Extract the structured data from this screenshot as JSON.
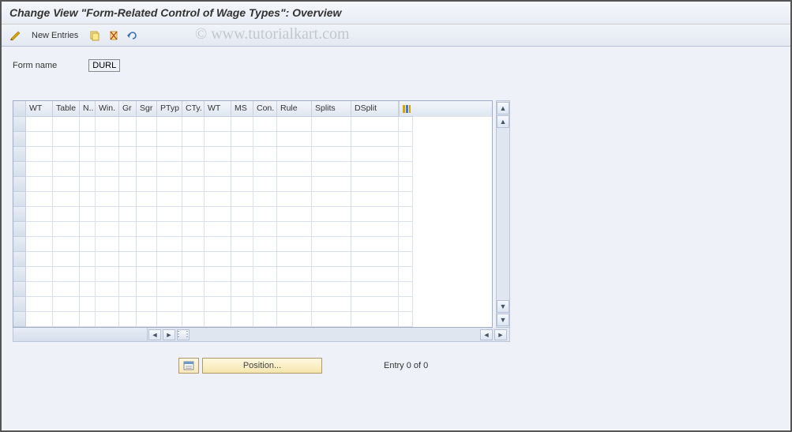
{
  "title": "Change View \"Form-Related Control of Wage Types\": Overview",
  "toolbar": {
    "new_entries": "New Entries"
  },
  "watermark": "© www.tutorialkart.com",
  "form": {
    "label": "Form name",
    "value": "DURL"
  },
  "grid": {
    "columns": [
      "WT",
      "Table",
      "N..",
      "Win.",
      "Gr",
      "Sgr",
      "PTyp",
      "CTy.",
      "WT",
      "MS",
      "Con.",
      "Rule",
      "Splits",
      "DSplit"
    ],
    "row_count": 14
  },
  "footer": {
    "position_label": "Position...",
    "entry_status": "Entry 0 of 0"
  }
}
